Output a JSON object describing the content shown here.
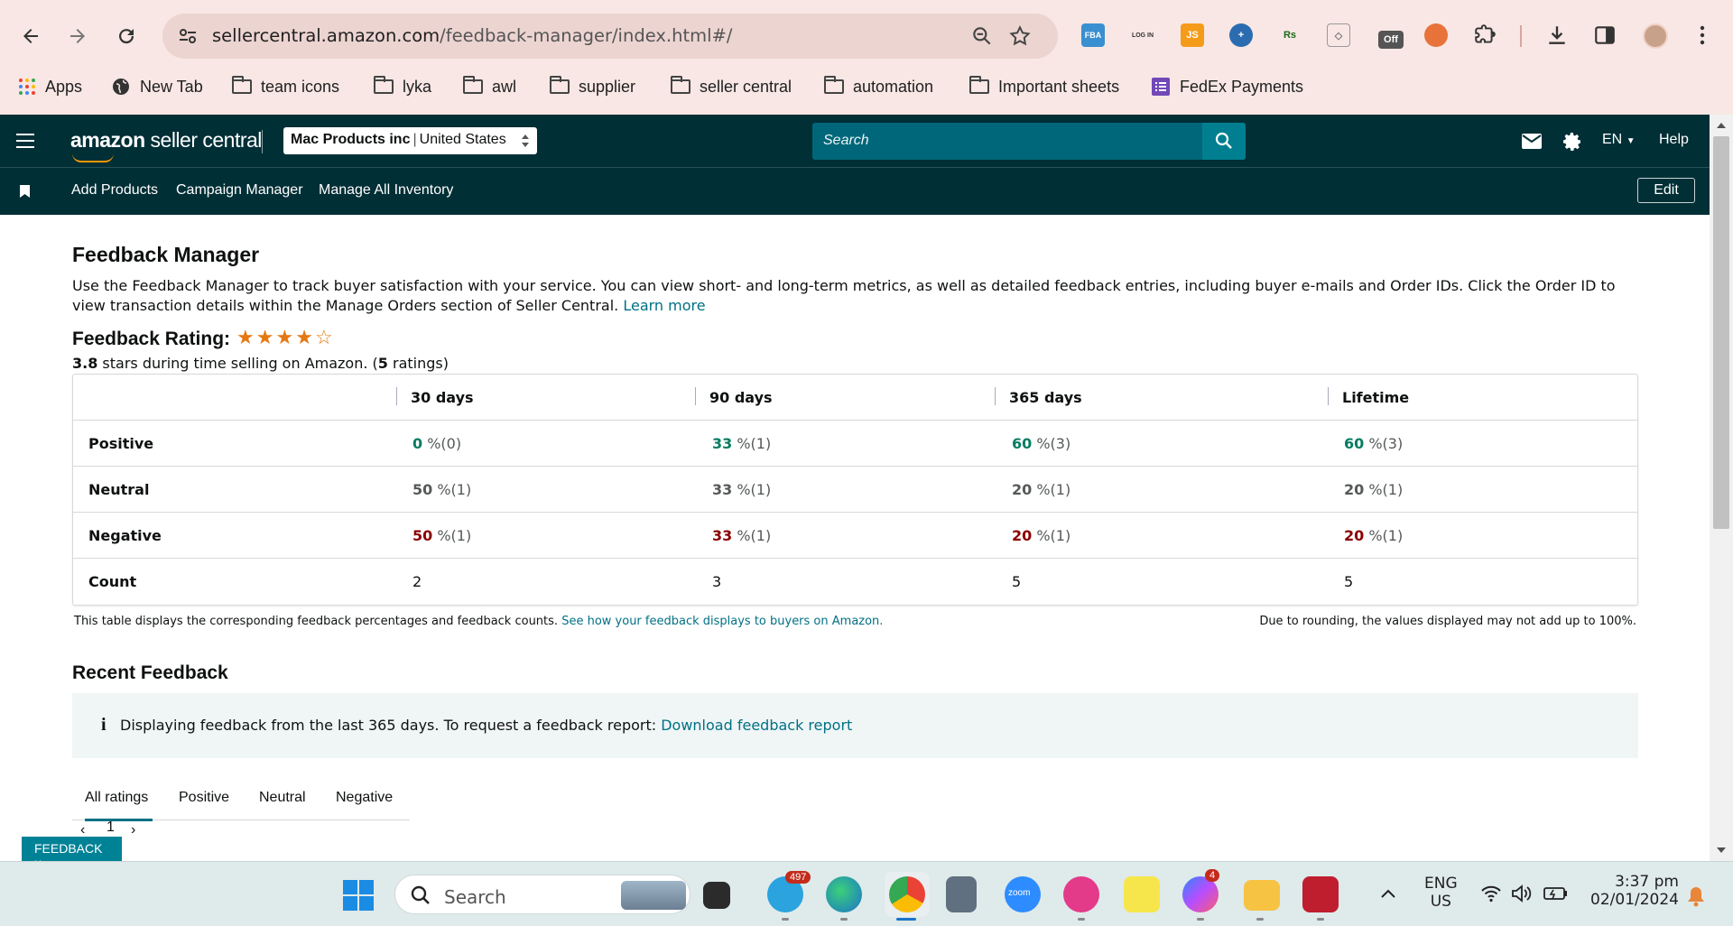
{
  "browser": {
    "url_host": "sellercentral.amazon.com",
    "url_path": "/feedback-manager/index.html#/",
    "extensions": [
      "FBA",
      "LOG IN",
      "JS",
      "Rs",
      "Off"
    ],
    "bookmarks": [
      "Apps",
      "New Tab",
      "team icons",
      "lyka",
      "awl",
      "supplier",
      "seller central",
      "automation",
      "Important sheets",
      "FedEx Payments"
    ]
  },
  "header": {
    "logo_bold": "amazon",
    "logo_rest": " seller central",
    "account_name": "Mac Products inc",
    "account_sep": "|",
    "account_region": "United States",
    "search_placeholder": "Search",
    "language": "EN",
    "help": "Help"
  },
  "subnav": {
    "links": [
      "Add Products",
      "Campaign Manager",
      "Manage All Inventory"
    ],
    "edit": "Edit"
  },
  "page": {
    "title": "Feedback Manager",
    "intro": "Use the Feedback Manager to track buyer satisfaction with your service. You can view short- and long-term metrics, as well as detailed feedback entries, including buyer e-mails and Order IDs. Click the Order ID to view transaction details within the Manage Orders section of Seller Central.",
    "learn_more": "Learn more",
    "rating_title": "Feedback Rating:",
    "stars_filled": 4,
    "stars_total": 5,
    "rating_value": "3.8",
    "rating_sub_a": " stars during time selling on Amazon. (",
    "rating_count": "5",
    "rating_sub_b": " ratings)"
  },
  "table": {
    "columns": [
      "30 days",
      "90 days",
      "365 days",
      "Lifetime"
    ],
    "rows": [
      {
        "label": "Positive",
        "cells": [
          [
            "0",
            " %(0)"
          ],
          [
            "33",
            " %(1)"
          ],
          [
            "60",
            " %(3)"
          ],
          [
            "60",
            " %(3)"
          ]
        ]
      },
      {
        "label": "Neutral",
        "cells": [
          [
            "50",
            " %(1)"
          ],
          [
            "33",
            " %(1)"
          ],
          [
            "20",
            " %(1)"
          ],
          [
            "20",
            " %(1)"
          ]
        ]
      },
      {
        "label": "Negative",
        "cells": [
          [
            "50",
            " %(1)"
          ],
          [
            "33",
            " %(1)"
          ],
          [
            "20",
            " %(1)"
          ],
          [
            "20",
            " %(1)"
          ]
        ]
      },
      {
        "label": "Count",
        "cells": [
          [
            "2",
            ""
          ],
          [
            "3",
            ""
          ],
          [
            "5",
            ""
          ],
          [
            "5",
            ""
          ]
        ]
      }
    ],
    "note": "This table displays the corresponding feedback percentages and feedback counts.",
    "note_link": "See how your feedback displays to buyers on Amazon.",
    "note_right": "Due to rounding, the values displayed may not add up to 100%."
  },
  "recent": {
    "title": "Recent Feedback",
    "info_icon": "i",
    "alert_text": "Displaying feedback from the last 365 days. To request a feedback report: ",
    "alert_link": "Download feedback report",
    "tabs": [
      "All ratings",
      "Positive",
      "Neutral",
      "Negative"
    ],
    "page": "1"
  },
  "feedback_tag": "FEEDBACK ×",
  "taskbar": {
    "search": "Search",
    "telegram_badge": "497",
    "messenger_badge": "4",
    "lang_top": "ENG",
    "lang_bottom": "US",
    "time": "3:37 pm",
    "date": "02/01/2024",
    "zoom_label": "zoom"
  },
  "colors": {
    "header_bg": "#002f36",
    "search_bg": "#00677a",
    "link": "#007185",
    "positive": "#067d62",
    "negative": "#8b0000",
    "neutral": "#565959",
    "star": "#e47911"
  }
}
